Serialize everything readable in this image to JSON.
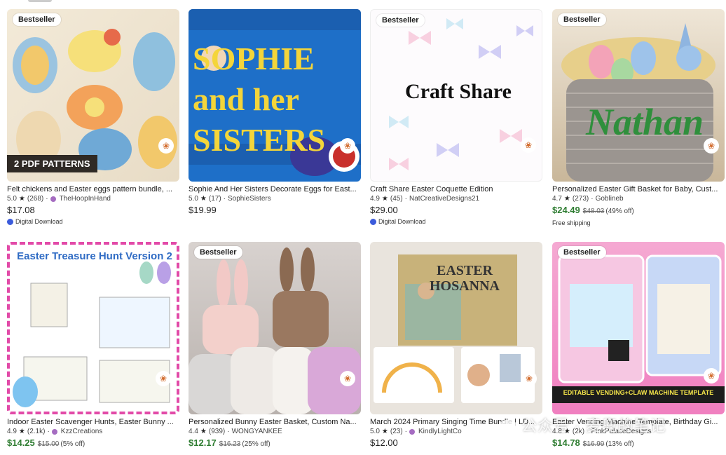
{
  "listings": [
    {
      "badge": "Bestseller",
      "title": "Felt chickens and Easter eggs pattern bundle, ...",
      "rating": "5.0",
      "reviews": "(268)",
      "shop": "TheHoopInHand",
      "shop_badge": true,
      "price": "$17.08",
      "sale": false,
      "original": "",
      "discount": "",
      "extra": "Digital Download",
      "overlay": "2 PDF PATTERNS"
    },
    {
      "badge": "",
      "title": "Sophie And Her Sisters Decorate Eggs for East...",
      "rating": "5.0",
      "reviews": "(17)",
      "shop": "SophieSisters",
      "shop_badge": false,
      "price": "$19.99",
      "sale": false,
      "original": "",
      "discount": "",
      "extra": "",
      "overlay": "SOPHIE and her SISTERS"
    },
    {
      "badge": "Bestseller",
      "title": "Craft Share Easter Coquette Edition",
      "rating": "4.9",
      "reviews": "(45)",
      "shop": "NatCreativeDesigns21",
      "shop_badge": false,
      "price": "$29.00",
      "sale": false,
      "original": "",
      "discount": "",
      "extra": "Digital Download",
      "overlay": "Craft Share"
    },
    {
      "badge": "Bestseller",
      "title": "Personalized Easter Gift Basket for Baby, Cust...",
      "rating": "4.7",
      "reviews": "(273)",
      "shop": "Goblineb",
      "shop_badge": false,
      "price": "$24.49",
      "sale": true,
      "original": "$48.03",
      "discount": "(49% off)",
      "extra": "Free shipping",
      "overlay": "Nathan"
    },
    {
      "badge": "",
      "title": "Indoor Easter Scavenger Hunts, Easter Bunny ...",
      "rating": "4.9",
      "reviews": "(2.1k)",
      "shop": "KzzCreations",
      "shop_badge": true,
      "price": "$14.25",
      "sale": true,
      "original": "$15.00",
      "discount": "(5% off)",
      "extra": "",
      "overlay": "Easter Treasure Hunt Version 2"
    },
    {
      "badge": "Bestseller",
      "title": "Personalized Bunny Easter Basket, Custom Na...",
      "rating": "4.4",
      "reviews": "(939)",
      "shop": "WONGYANKEE",
      "shop_badge": false,
      "price": "$12.17",
      "sale": true,
      "original": "$16.23",
      "discount": "(25% off)",
      "extra": "",
      "overlay": ""
    },
    {
      "badge": "",
      "title": "March 2024 Primary Singing Time Bundle | LD...",
      "rating": "5.0",
      "reviews": "(23)",
      "shop": "KindlyLightCo",
      "shop_badge": true,
      "price": "$12.00",
      "sale": false,
      "original": "",
      "discount": "",
      "extra": "",
      "overlay": "EASTER HOSANNA"
    },
    {
      "badge": "Bestseller",
      "title": "Easter Vending Machine Template, Birthday Gi...",
      "rating": "4.8",
      "reviews": "(2k)",
      "shop": "PinkPalaceDesigns",
      "shop_badge": false,
      "price": "$14.78",
      "sale": true,
      "original": "$16.99",
      "discount": "(13% off)",
      "extra": "",
      "overlay": "EDITABLE VENDING+CLAW MACHINE TEMPLATE"
    }
  ],
  "star_glyph": "★",
  "watermark": "公众号 · 麦兜的笔记",
  "colors": {
    "sale": "#2f7d32",
    "badge_bg": "#ffffff"
  }
}
